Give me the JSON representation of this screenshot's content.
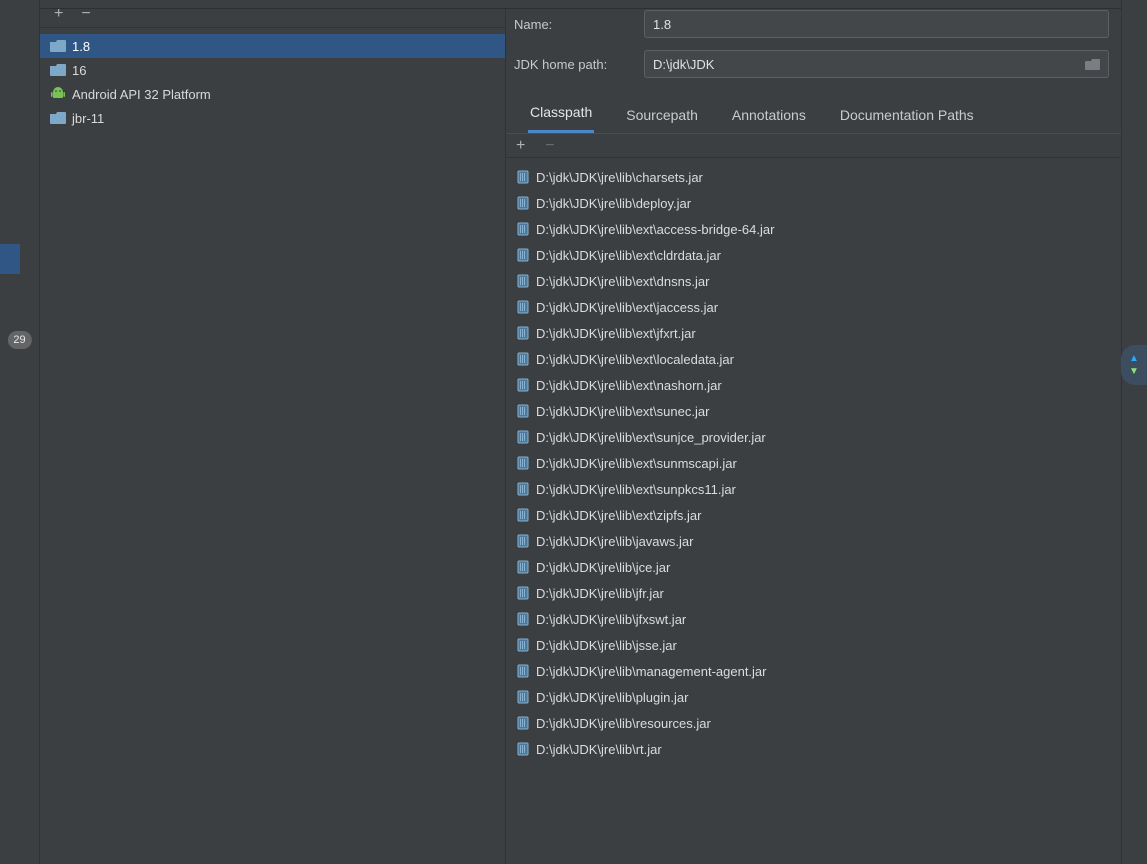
{
  "gutter": {
    "badge": "29"
  },
  "sdkTree": {
    "items": [
      {
        "label": "1.8",
        "iconType": "folder",
        "selected": true
      },
      {
        "label": "16",
        "iconType": "folder",
        "selected": false
      },
      {
        "label": "Android API 32 Platform",
        "iconType": "android",
        "selected": false
      },
      {
        "label": "jbr-11",
        "iconType": "folder",
        "selected": false
      }
    ]
  },
  "form": {
    "nameLabel": "Name:",
    "nameValue": "1.8",
    "pathLabel": "JDK home path:",
    "pathValue": "D:\\jdk\\JDK"
  },
  "tabs": [
    {
      "label": "Classpath",
      "active": true
    },
    {
      "label": "Sourcepath",
      "active": false
    },
    {
      "label": "Annotations",
      "active": false
    },
    {
      "label": "Documentation Paths",
      "active": false
    }
  ],
  "jars": [
    "D:\\jdk\\JDK\\jre\\lib\\charsets.jar",
    "D:\\jdk\\JDK\\jre\\lib\\deploy.jar",
    "D:\\jdk\\JDK\\jre\\lib\\ext\\access-bridge-64.jar",
    "D:\\jdk\\JDK\\jre\\lib\\ext\\cldrdata.jar",
    "D:\\jdk\\JDK\\jre\\lib\\ext\\dnsns.jar",
    "D:\\jdk\\JDK\\jre\\lib\\ext\\jaccess.jar",
    "D:\\jdk\\JDK\\jre\\lib\\ext\\jfxrt.jar",
    "D:\\jdk\\JDK\\jre\\lib\\ext\\localedata.jar",
    "D:\\jdk\\JDK\\jre\\lib\\ext\\nashorn.jar",
    "D:\\jdk\\JDK\\jre\\lib\\ext\\sunec.jar",
    "D:\\jdk\\JDK\\jre\\lib\\ext\\sunjce_provider.jar",
    "D:\\jdk\\JDK\\jre\\lib\\ext\\sunmscapi.jar",
    "D:\\jdk\\JDK\\jre\\lib\\ext\\sunpkcs11.jar",
    "D:\\jdk\\JDK\\jre\\lib\\ext\\zipfs.jar",
    "D:\\jdk\\JDK\\jre\\lib\\javaws.jar",
    "D:\\jdk\\JDK\\jre\\lib\\jce.jar",
    "D:\\jdk\\JDK\\jre\\lib\\jfr.jar",
    "D:\\jdk\\JDK\\jre\\lib\\jfxswt.jar",
    "D:\\jdk\\JDK\\jre\\lib\\jsse.jar",
    "D:\\jdk\\JDK\\jre\\lib\\management-agent.jar",
    "D:\\jdk\\JDK\\jre\\lib\\plugin.jar",
    "D:\\jdk\\JDK\\jre\\lib\\resources.jar",
    "D:\\jdk\\JDK\\jre\\lib\\rt.jar"
  ]
}
